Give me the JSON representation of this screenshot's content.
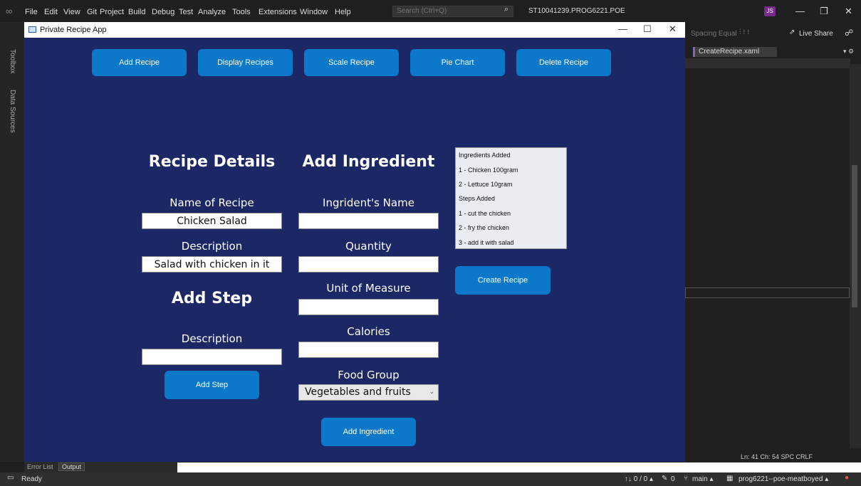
{
  "vs": {
    "menu": [
      "File",
      "Edit",
      "View",
      "Git",
      "Project",
      "Build",
      "Debug",
      "Test",
      "Analyze",
      "Tools",
      "Extensions",
      "Window",
      "Help"
    ],
    "search_placeholder": "Search (Ctrl+Q)",
    "solution_name": "ST10041239.PROG6221.POE",
    "avatar_initials": "JS",
    "live_share": "Live Share",
    "toolbar_text": "Spacing Equal",
    "editor_tab": "CreateRecipe.xaml",
    "left_strip": [
      "Toolbox",
      "Data Sources"
    ],
    "editor_status": "Ln: 41   Ch: 54   SPC   CRLF",
    "bottom_tabs": [
      "Error List",
      "Output"
    ],
    "status": {
      "ready": "Ready",
      "changes": "↑↓ 0 / 0 ▴",
      "pencil": "0",
      "branch": "main ▴",
      "repo": "prog6221--poe-meatboyed ▴"
    }
  },
  "app": {
    "title": "Private Recipe App",
    "nav": [
      "Add Recipe",
      "Display Recipes",
      "Scale Recipe",
      "Pie Chart",
      "Delete Recipe"
    ],
    "recipe": {
      "heading": "Recipe Details",
      "name_label": "Name of Recipe",
      "name_value": "Chicken Salad",
      "desc_label": "Description",
      "desc_value": "Salad with chicken in it"
    },
    "step": {
      "heading": "Add Step",
      "desc_label": "Description",
      "desc_value": "",
      "button": "Add Step"
    },
    "ingredient": {
      "heading": "Add Ingredient",
      "name_label": "Ingrident's Name",
      "quantity_label": "Quantity",
      "unit_label": "Unit of Measure",
      "calories_label": "Calories",
      "food_group_label": "Food Group",
      "food_group_value": "Vegetables and fruits",
      "button": "Add Ingredient"
    },
    "summary": [
      "Ingredients Added",
      "1 - Chicken 100gram",
      "2 - Lettuce 10gram",
      "Steps Added",
      "1 - cut the chicken",
      "2 - fry the chicken",
      "3 - add it with salad"
    ],
    "create_button": "Create Recipe"
  }
}
